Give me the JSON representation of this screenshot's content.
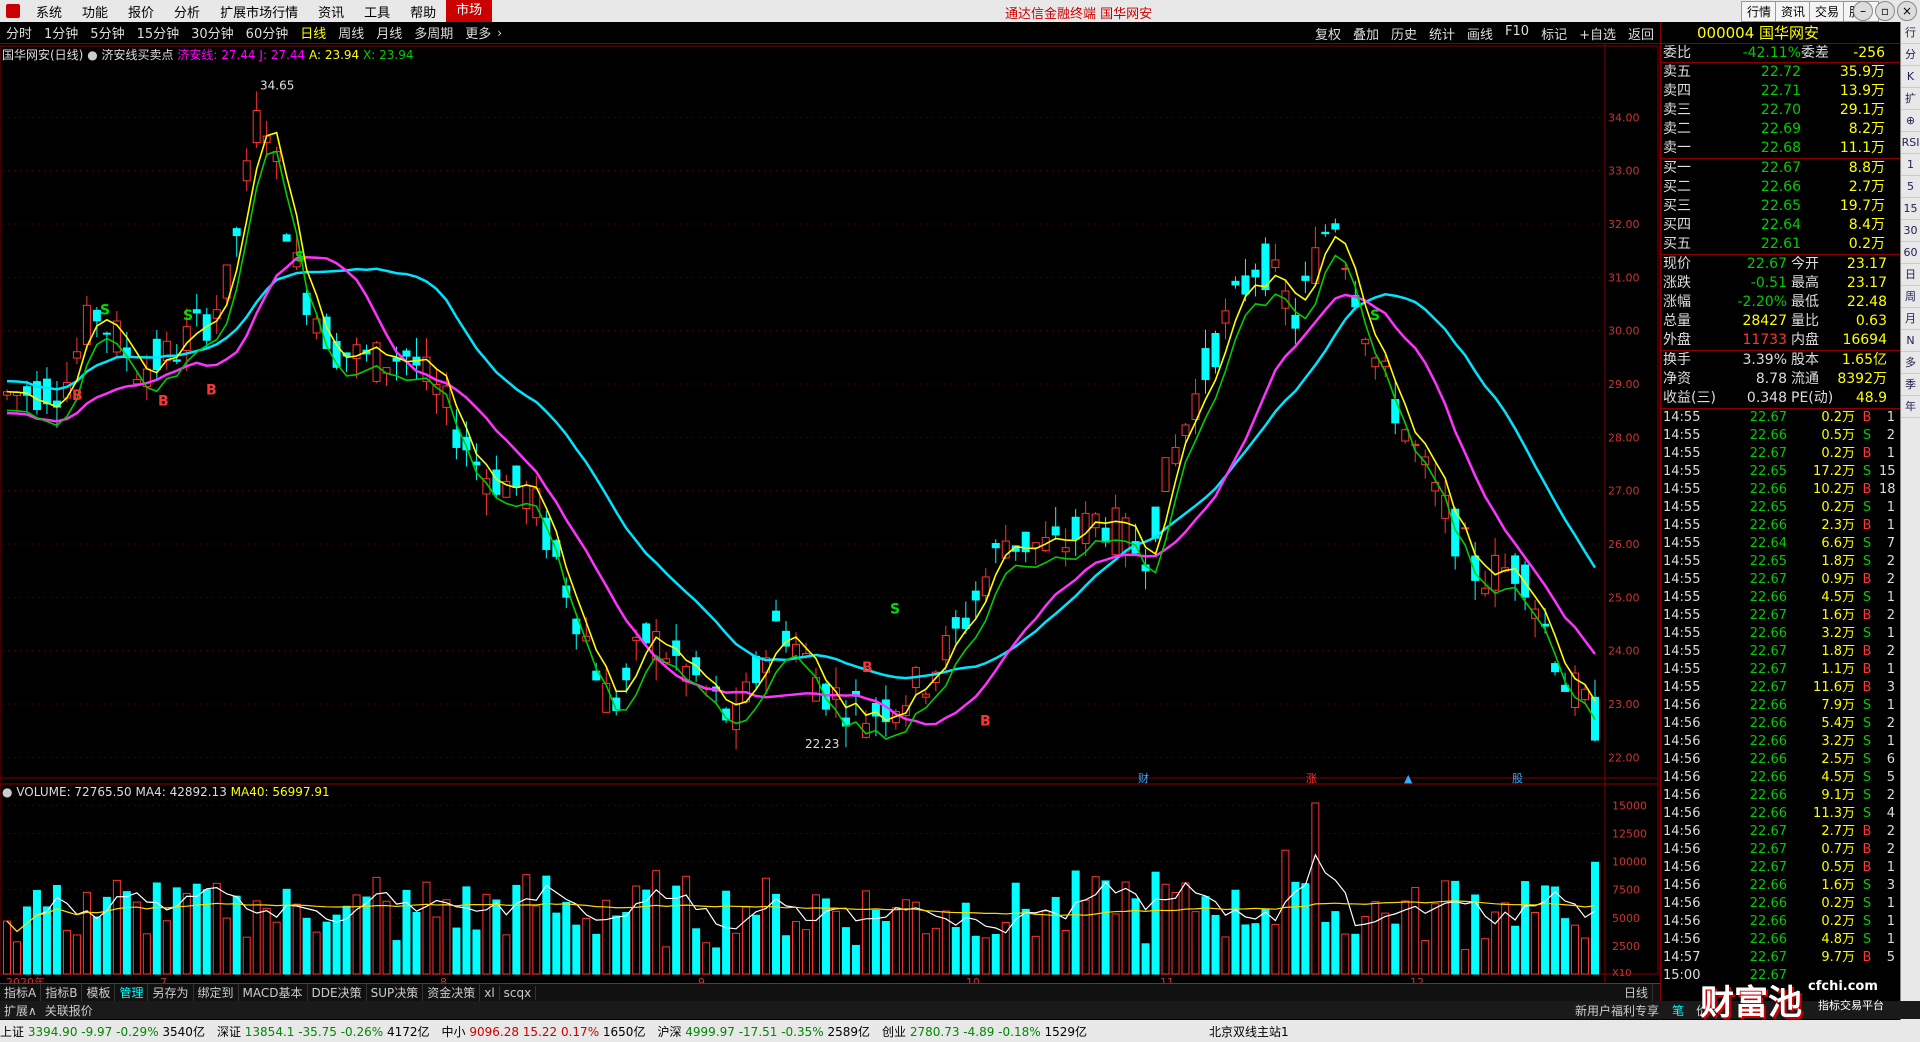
{
  "menubar": {
    "items": [
      "系统",
      "功能",
      "报价",
      "分析",
      "扩展市场行情",
      "资讯",
      "工具",
      "帮助"
    ],
    "active": "市场",
    "center_title": "通达信金融终端 国华网安",
    "right_buttons": [
      "行情",
      "资讯",
      "交易",
      "服务"
    ]
  },
  "toolbar": {
    "periods": [
      "分时",
      "1分钟",
      "5分钟",
      "15分钟",
      "30分钟",
      "60分钟",
      "日线",
      "周线",
      "月线",
      "多周期",
      "更多"
    ],
    "selected": "日线",
    "right": [
      "复权",
      "叠加",
      "历史",
      "统计",
      "画线",
      "F10",
      "标记",
      "+自选",
      "返回"
    ]
  },
  "legend_main": {
    "title": "国华网安(日线)",
    "indicator": "济安线买卖点",
    "items": [
      {
        "label": "济安线: 27.44",
        "color": "#ff33ff"
      },
      {
        "label": "J: 27.44",
        "color": "#00ffff"
      },
      {
        "label": "A: 23.94",
        "color": "#ffff00"
      },
      {
        "label": "X: 23.94",
        "color": "#00cc00"
      }
    ]
  },
  "legend_vol": {
    "items": [
      {
        "label": "VOLUME: 72765.50",
        "color": "#dddddd"
      },
      {
        "label": "MA4: 42892.13",
        "color": "#dddddd"
      },
      {
        "label": "MA40: 56997.91",
        "color": "#ffff00"
      }
    ]
  },
  "chart_data": [
    {
      "type": "candlestick",
      "title": "国华网安(日线)",
      "ylim": [
        21.5,
        35.0
      ],
      "y_ticks": [
        "34.00",
        "33.00",
        "32.00",
        "31.00",
        "30.00",
        "29.00",
        "28.00",
        "27.00",
        "26.00",
        "25.00",
        "24.00",
        "23.00",
        "22.00"
      ],
      "x_labels": [
        "2020年",
        "7",
        "8",
        "9",
        "10",
        "11",
        "12"
      ],
      "annotations": [
        "34.65",
        "22.23"
      ],
      "markers_text": [
        "S",
        "S",
        "S",
        "S",
        "S",
        "B",
        "B",
        "B",
        "B",
        "B"
      ],
      "event_labels": [
        "财",
        "涨",
        "▲",
        "股"
      ],
      "series": [
        {
          "name": "济安线",
          "color": "#ff33ff"
        },
        {
          "name": "J",
          "color": "#00ffff"
        },
        {
          "name": "A",
          "color": "#ffff00"
        },
        {
          "name": "X",
          "color": "#00cc00"
        }
      ]
    },
    {
      "type": "bar",
      "title": "VOLUME",
      "ylim": [
        0,
        16000
      ],
      "y_ticks": [
        "15000",
        "12500",
        "10000",
        "7500",
        "5000",
        "2500"
      ],
      "unit_label": "X10",
      "series": [
        {
          "name": "VOLUME"
        },
        {
          "name": "MA4"
        },
        {
          "name": "MA40"
        }
      ]
    }
  ],
  "quote": {
    "code_name": "000004 国华网安",
    "ratio": {
      "label": "委比",
      "value": "-42.11%",
      "label2": "委差",
      "value2": "-256"
    },
    "sells": [
      {
        "l": "卖五",
        "p": "22.72",
        "v": "35.9万"
      },
      {
        "l": "卖四",
        "p": "22.71",
        "v": "13.9万"
      },
      {
        "l": "卖三",
        "p": "22.70",
        "v": "29.1万"
      },
      {
        "l": "卖二",
        "p": "22.69",
        "v": "8.2万"
      },
      {
        "l": "卖一",
        "p": "22.68",
        "v": "11.1万"
      }
    ],
    "buys": [
      {
        "l": "买一",
        "p": "22.67",
        "v": "8.8万"
      },
      {
        "l": "买二",
        "p": "22.66",
        "v": "2.7万"
      },
      {
        "l": "买三",
        "p": "22.65",
        "v": "19.7万"
      },
      {
        "l": "买四",
        "p": "22.64",
        "v": "8.4万"
      },
      {
        "l": "买五",
        "p": "22.61",
        "v": "0.2万"
      }
    ],
    "stats": [
      {
        "a": "现价",
        "b": "22.67",
        "c": "今开",
        "d": "23.17"
      },
      {
        "a": "涨跌",
        "b": "-0.51",
        "c": "最高",
        "d": "23.17"
      },
      {
        "a": "涨幅",
        "b": "-2.20%",
        "c": "最低",
        "d": "22.48"
      },
      {
        "a": "总量",
        "b": "28427",
        "c": "量比",
        "d": "0.63"
      },
      {
        "a": "外盘",
        "b": "11733",
        "c": "内盘",
        "d": "16694"
      }
    ],
    "stats2": [
      {
        "a": "换手",
        "b": "3.39%",
        "c": "股本",
        "d": "1.65亿"
      },
      {
        "a": "净资",
        "b": "8.78",
        "c": "流通",
        "d": "8392万"
      },
      {
        "a": "收益(三)",
        "b": "0.348",
        "c": "PE(动)",
        "d": "48.9"
      }
    ],
    "ticks": [
      [
        "14:55",
        "22.67",
        "0.2万",
        "B",
        "1"
      ],
      [
        "14:55",
        "22.66",
        "0.5万",
        "S",
        "2"
      ],
      [
        "14:55",
        "22.67",
        "0.2万",
        "B",
        "1"
      ],
      [
        "14:55",
        "22.65",
        "17.2万",
        "S",
        "15"
      ],
      [
        "14:55",
        "22.66",
        "10.2万",
        "B",
        "18"
      ],
      [
        "14:55",
        "22.65",
        "0.2万",
        "S",
        "1"
      ],
      [
        "14:55",
        "22.66",
        "2.3万",
        "B",
        "1"
      ],
      [
        "14:55",
        "22.64",
        "6.6万",
        "S",
        "7"
      ],
      [
        "14:55",
        "22.65",
        "1.8万",
        "S",
        "2"
      ],
      [
        "14:55",
        "22.67",
        "0.9万",
        "B",
        "2"
      ],
      [
        "14:55",
        "22.66",
        "4.5万",
        "S",
        "1"
      ],
      [
        "14:55",
        "22.67",
        "1.6万",
        "B",
        "2"
      ],
      [
        "14:55",
        "22.66",
        "3.2万",
        "S",
        "1"
      ],
      [
        "14:55",
        "22.67",
        "1.8万",
        "B",
        "2"
      ],
      [
        "14:55",
        "22.67",
        "1.1万",
        "B",
        "1"
      ],
      [
        "14:55",
        "22.67",
        "11.6万",
        "B",
        "3"
      ],
      [
        "14:56",
        "22.66",
        "7.9万",
        "S",
        "1"
      ],
      [
        "14:56",
        "22.66",
        "5.4万",
        "S",
        "2"
      ],
      [
        "14:56",
        "22.66",
        "3.2万",
        "S",
        "1"
      ],
      [
        "14:56",
        "22.66",
        "2.5万",
        "S",
        "6"
      ],
      [
        "14:56",
        "22.66",
        "4.5万",
        "S",
        "5"
      ],
      [
        "14:56",
        "22.66",
        "9.1万",
        "S",
        "2"
      ],
      [
        "14:56",
        "22.66",
        "11.3万",
        "S",
        "4"
      ],
      [
        "14:56",
        "22.67",
        "2.7万",
        "B",
        "2"
      ],
      [
        "14:56",
        "22.67",
        "0.7万",
        "B",
        "2"
      ],
      [
        "14:56",
        "22.67",
        "0.5万",
        "B",
        "1"
      ],
      [
        "14:56",
        "22.66",
        "1.6万",
        "S",
        "3"
      ],
      [
        "14:56",
        "22.66",
        "0.2万",
        "S",
        "1"
      ],
      [
        "14:56",
        "22.66",
        "0.2万",
        "S",
        "1"
      ],
      [
        "14:56",
        "22.66",
        "4.8万",
        "S",
        "1"
      ],
      [
        "14:57",
        "22.67",
        "9.7万",
        "B",
        "5"
      ],
      [
        "15:00",
        "22.67",
        "",
        "",
        ""
      ]
    ]
  },
  "bottom_tabs": [
    "指标A",
    "指标B",
    "模板",
    "管理",
    "另存为",
    "绑定到",
    "MACD基本",
    "DDE决策",
    "SUP决策",
    "资金决策",
    "xl",
    "scqx"
  ],
  "bottom_selected": "管理",
  "bottom_right": "日线",
  "expand": {
    "a": "扩展∧",
    "b": "关联报价",
    "c": "新用户福利专享",
    "d": "笔",
    "e": "价"
  },
  "statusbar": [
    {
      "name": "上证",
      "v": "3394.90",
      "c": "-9.97",
      "p": "-0.29%",
      "a": "3540亿"
    },
    {
      "name": "深证",
      "v": "13854.1",
      "c": "-35.75",
      "p": "-0.26%",
      "a": "4172亿"
    },
    {
      "name": "中小",
      "v": "9096.28",
      "c": "15.22",
      "p": "0.17%",
      "a": "1650亿"
    },
    {
      "name": "沪深",
      "v": "4999.97",
      "c": "-17.51",
      "p": "-0.35%",
      "a": "2589亿"
    },
    {
      "name": "创业",
      "v": "2780.73",
      "c": "-4.89",
      "p": "-0.18%",
      "a": "1529亿"
    }
  ],
  "status_server": "北京双线主站1",
  "sidebar": [
    "行",
    "分",
    "K",
    "扩",
    "⊕",
    "RSI",
    "1",
    "5",
    "15",
    "30",
    "60",
    "日",
    "周",
    "月",
    "N",
    "多",
    "季",
    "年"
  ],
  "watermark": {
    "text": "财富池",
    "url": "cfchi.com",
    "sub": "指标交易平台"
  }
}
